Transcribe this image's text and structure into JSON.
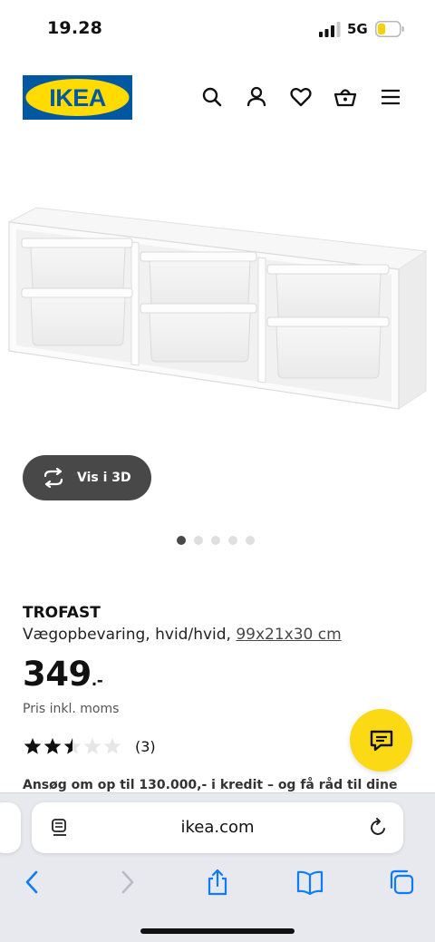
{
  "status": {
    "time": "19.28",
    "network": "5G"
  },
  "header": {
    "logo_text": "IKEA",
    "brand_blue": "#0058a3",
    "brand_yellow": "#ffdb00"
  },
  "gallery": {
    "view_3d_label": "Vis i 3D",
    "dot_count": 5,
    "active_dot": 0
  },
  "product": {
    "name": "TROFAST",
    "description": "Vægopbevaring, hvid/hvid, ",
    "dimensions": "99x21x30 cm",
    "price": "349",
    "price_suffix": ".-",
    "price_note": "Pris inkl. moms",
    "rating": 2.5,
    "rating_max": 5,
    "review_count": "(3)",
    "credit_text": "Ansøg om op til 130.000,- i kredit – og få råd til dine"
  },
  "browser": {
    "url": "ikea.com"
  },
  "icons": {
    "header": [
      "search-icon",
      "account-icon",
      "heart-icon",
      "basket-icon",
      "menu-icon"
    ],
    "toolbar": [
      "back-icon",
      "forward-icon",
      "share-icon",
      "bookmarks-icon",
      "tabs-icon"
    ]
  },
  "colors": {
    "accent_blue": "#0a7cff",
    "chat_yellow": "#fbd914",
    "button_dark": "#484848"
  }
}
